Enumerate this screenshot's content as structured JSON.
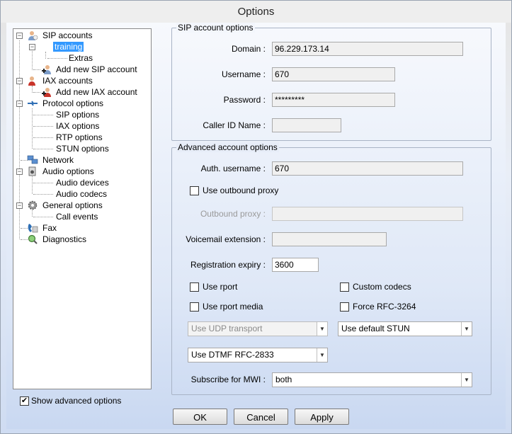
{
  "window": {
    "title": "Options"
  },
  "tree": {
    "sip_accounts": "SIP accounts",
    "training": "training",
    "extras": "Extras",
    "add_sip": "Add new SIP account",
    "iax_accounts": "IAX accounts",
    "add_iax": "Add new IAX account",
    "protocol_options": "Protocol options",
    "sip_options": "SIP options",
    "iax_options": "IAX options",
    "rtp_options": "RTP options",
    "stun_options": "STUN options",
    "network": "Network",
    "audio_options": "Audio options",
    "audio_devices": "Audio devices",
    "audio_codecs": "Audio codecs",
    "general_options": "General options",
    "call_events": "Call events",
    "fax": "Fax",
    "diagnostics": "Diagnostics"
  },
  "show_advanced": {
    "label": "Show advanced options",
    "checked": true
  },
  "sip_account": {
    "legend": "SIP account options",
    "domain_label": "Domain :",
    "domain": "96.229.173.14",
    "username_label": "Username :",
    "username": "670",
    "password_label": "Password :",
    "password": "*********",
    "callerid_label": "Caller ID Name :",
    "callerid": ""
  },
  "advanced": {
    "legend": "Advanced account options",
    "auth_label": "Auth. username :",
    "auth": "670",
    "use_proxy_label": "Use outbound proxy",
    "proxy_label": "Outbound proxy :",
    "proxy": "",
    "voicemail_label": "Voicemail extension :",
    "voicemail": "",
    "expiry_label": "Registration expiry :",
    "expiry": "3600",
    "rport_label": "Use rport",
    "custom_codecs_label": "Custom codecs",
    "rport_media_label": "Use rport media",
    "rfc3264_label": "Force RFC-3264",
    "transport": "Use UDP transport",
    "stun": "Use default STUN",
    "dtmf": "Use DTMF RFC-2833",
    "mwi_label": "Subscribe for MWI :",
    "mwi": "both"
  },
  "buttons": {
    "ok": "OK",
    "cancel": "Cancel",
    "apply": "Apply"
  }
}
